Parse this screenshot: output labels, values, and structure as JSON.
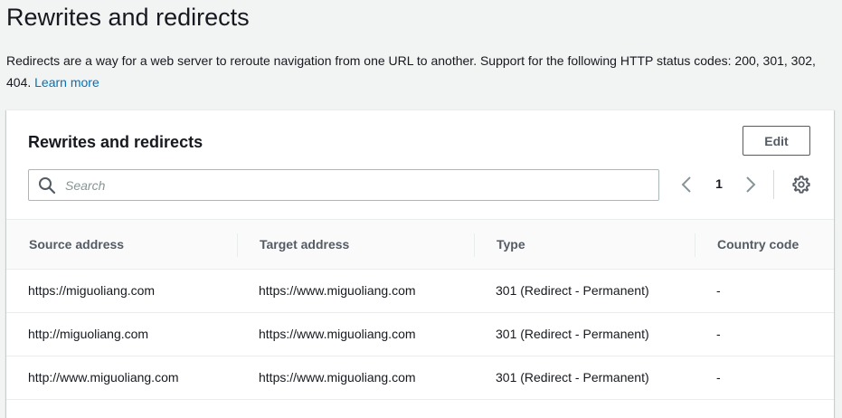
{
  "page": {
    "title": "Rewrites and redirects",
    "description": "Redirects are a way for a web server to reroute navigation from one URL to another. Support for the following HTTP status codes: 200, 301, 302, 404.",
    "learn_more": "Learn more"
  },
  "panel": {
    "title": "Rewrites and redirects",
    "edit_label": "Edit",
    "search": {
      "placeholder": "Search",
      "value": ""
    },
    "pagination": {
      "current_page": "1"
    }
  },
  "table": {
    "columns": [
      "Source address",
      "Target address",
      "Type",
      "Country code"
    ],
    "rows": [
      {
        "source": "https://miguoliang.com",
        "target": "https://www.miguoliang.com",
        "type": "301 (Redirect - Permanent)",
        "country": "-"
      },
      {
        "source": "http://miguoliang.com",
        "target": "https://www.miguoliang.com",
        "type": "301 (Redirect - Permanent)",
        "country": "-"
      },
      {
        "source": "http://www.miguoliang.com",
        "target": "https://www.miguoliang.com",
        "type": "301 (Redirect - Permanent)",
        "country": "-"
      }
    ]
  },
  "icons": {
    "search": "search-icon",
    "prev": "chevron-left-icon",
    "next": "chevron-right-icon",
    "settings": "gear-icon"
  },
  "colors": {
    "link": "#0073bb",
    "background": "#f2f3f3",
    "text": "#16191f",
    "muted": "#545b64"
  }
}
